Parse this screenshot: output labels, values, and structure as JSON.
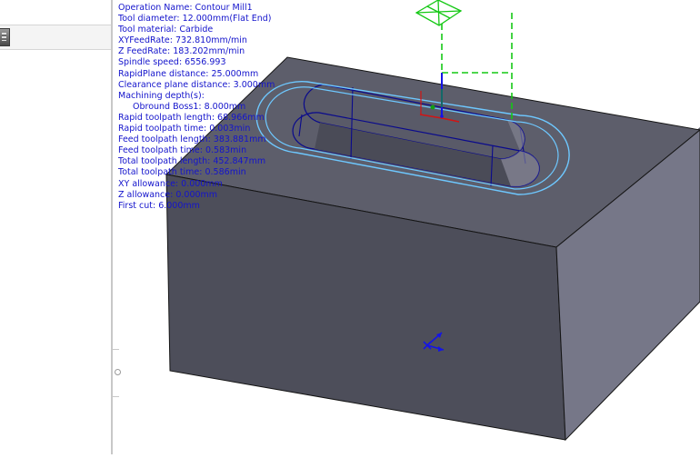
{
  "operation_info": {
    "operation_name": "Operation Name: Contour Mill1",
    "tool_diameter": "Tool diameter: 12.000mm(Flat End)",
    "tool_material": "Tool material: Carbide",
    "xy_feedrate": "XYFeedRate: 732.810mm/min",
    "z_feedrate": "Z FeedRate: 183.202mm/min",
    "spindle_speed": "Spindle speed: 6556.993",
    "rapid_plane_distance": "RapidPlane distance: 25.000mm",
    "clearance_plane_distance": "Clearance plane distance: 3.000mm",
    "machining_depths_header": "Machining depth(s):",
    "machining_depth_item": "Obround Boss1: 8.000mm",
    "rapid_toolpath_length": "Rapid toolpath length: 68.966mm",
    "rapid_toolpath_time": "Rapid toolpath time: 0.003min",
    "feed_toolpath_length": "Feed toolpath length: 383.881mm",
    "feed_toolpath_time": "Feed toolpath time: 0.583min",
    "total_toolpath_length": "Total toolpath length: 452.847mm",
    "total_toolpath_time": "Total toolpath time: 0.586min",
    "xy_allowance": "XY allowance: 0.000mm",
    "z_allowance": "Z allowance: 0.000mm",
    "first_cut": "First cut: 6.000mm"
  },
  "colors": {
    "info_text": "#1414cc",
    "block_top": "#5d5e6b",
    "block_front": "#4d4e5a",
    "block_side": "#757686",
    "edge": "#141414",
    "part_edge": "#0a0a8c",
    "toolpath": "#6ec8ff",
    "rapid_move": "#14c814",
    "triad_blue": "#1414e6",
    "triad_red": "#d21414",
    "triad_green": "#14a014"
  },
  "icons": {
    "panel_tool": "toolbar-tool-icon",
    "tool_glyph": "tool-position-icon",
    "triad": "coordinate-triad-icon",
    "origin": "origin-axis-icon",
    "splitter": "panel-splitter-handle"
  }
}
